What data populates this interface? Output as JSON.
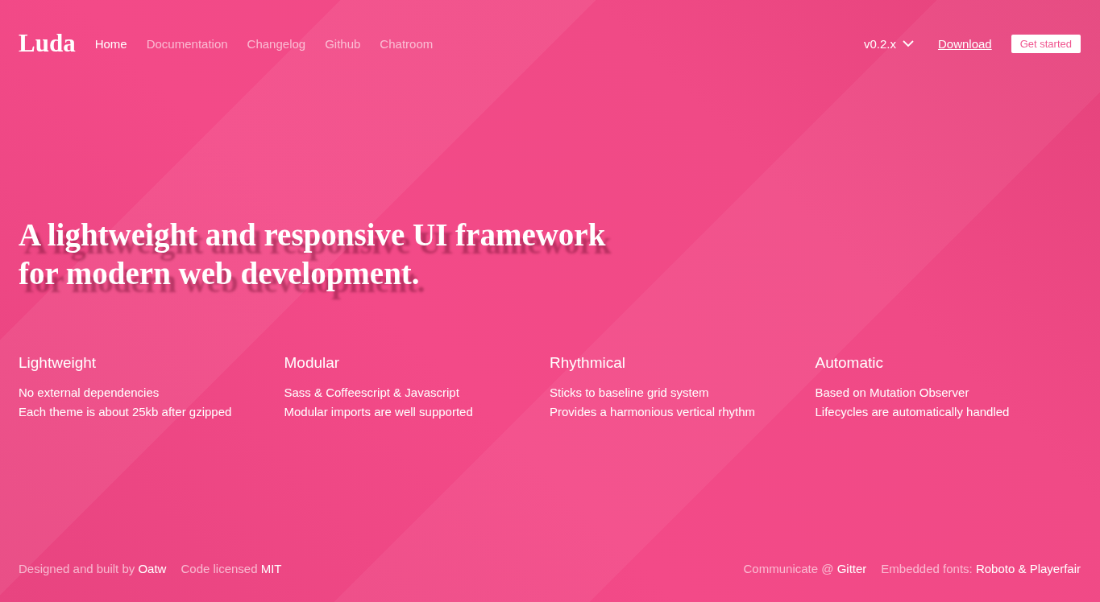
{
  "nav": {
    "logo": "Luda",
    "links": [
      {
        "label": "Home",
        "selected": true
      },
      {
        "label": "Documentation",
        "selected": false
      },
      {
        "label": "Changelog",
        "selected": false
      },
      {
        "label": "Github",
        "selected": false
      },
      {
        "label": "Chatroom",
        "selected": false
      }
    ],
    "version": "v0.2.x",
    "download": "Download",
    "cta": "Get started"
  },
  "hero": {
    "lines": [
      "A lightweight and responsive UI framework",
      "for modern web development."
    ]
  },
  "features": [
    {
      "title": "Lightweight",
      "lines": [
        "No external dependencies",
        "Each theme is about 25kb after gzipped"
      ]
    },
    {
      "title": "Modular",
      "lines": [
        "Sass & Coffeescript & Javascript",
        "Modular imports are well supported"
      ]
    },
    {
      "title": "Rhythmical",
      "lines": [
        "Sticks to baseline grid system",
        "Provides a harmonious vertical rhythm"
      ]
    },
    {
      "title": "Automatic",
      "lines": [
        "Based on Mutation Observer",
        "Lifecycles are automatically handled"
      ]
    }
  ],
  "footer": {
    "left": [
      {
        "text": "Designed and built by",
        "link": "Oatw"
      },
      {
        "text": "Code licensed",
        "link": "MIT"
      }
    ],
    "right": [
      {
        "text": "Communicate @",
        "link": "Gitter"
      },
      {
        "text": "Embedded fonts:",
        "link": "Roboto & Playerfair"
      }
    ]
  }
}
